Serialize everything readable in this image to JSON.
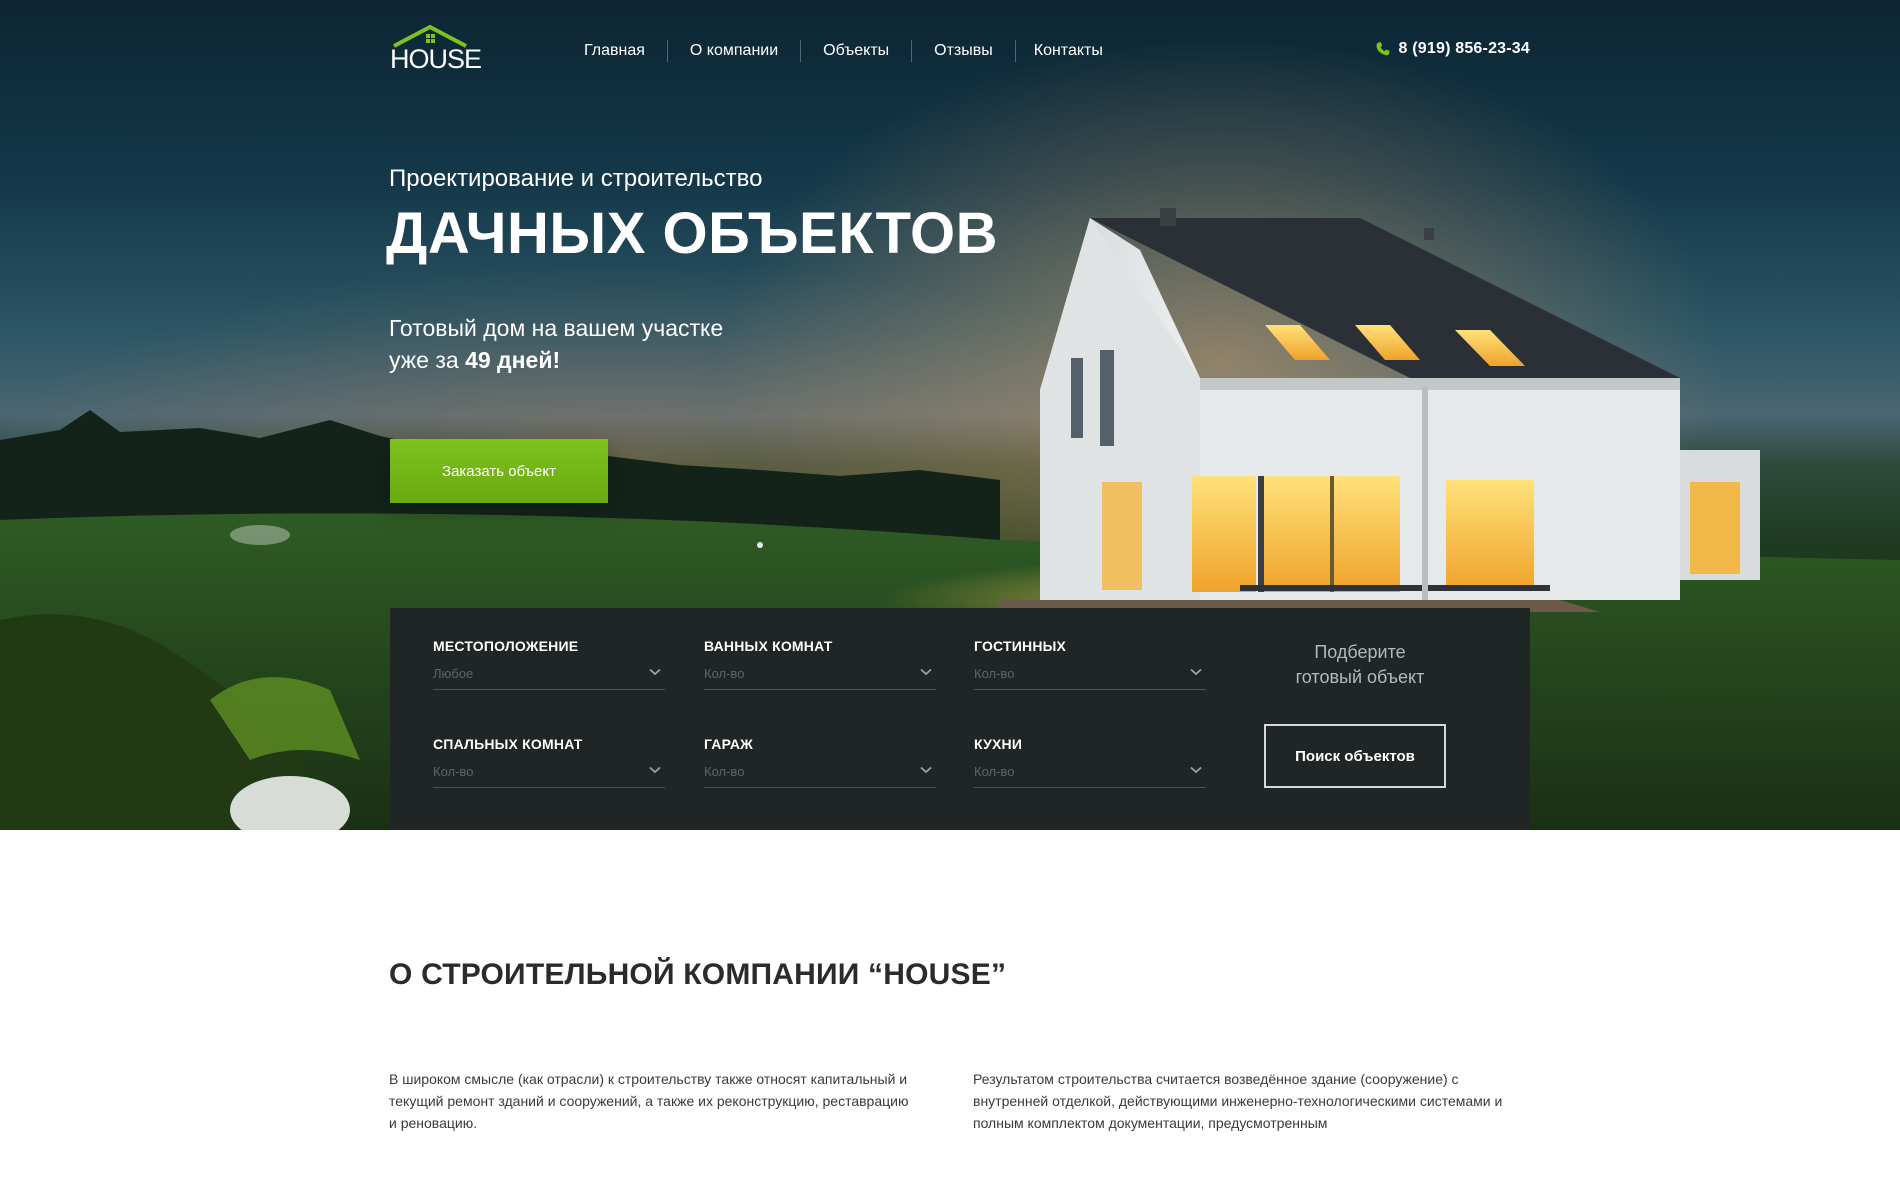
{
  "header": {
    "logo_text": "HOUSE",
    "nav": [
      "Главная",
      "О компании",
      "Объекты",
      "Отзывы",
      "Контакты"
    ],
    "phone": "8 (919) 856-23-34"
  },
  "hero": {
    "subtitle": "Проектирование и строительство",
    "title": "ДАЧНЫХ ОБЪЕКТОВ",
    "tagline_line1": "Готовый дом на вашем участке",
    "tagline_prefix": "уже за ",
    "tagline_bold": "49 дней!",
    "cta_label": "Заказать объект"
  },
  "search": {
    "fields": [
      {
        "label": "Местоположение",
        "value": "Любое"
      },
      {
        "label": "Ванных комнат",
        "value": "Кол-во"
      },
      {
        "label": "Гостинных",
        "value": "Кол-во"
      },
      {
        "label": "Спальных комнат",
        "value": "Кол-во"
      },
      {
        "label": "Гараж",
        "value": "Кол-во"
      },
      {
        "label": "Кухни",
        "value": "Кол-во"
      }
    ],
    "hint_line1": "Подберите",
    "hint_line2": "готовый объект",
    "button_label": "Поиск объектов"
  },
  "about": {
    "title": "О СТРОИТЕЛЬНОЙ КОМПАНИИ “HOUSE”",
    "left_text": "В широком смысле (как отрасли) к строительству также относят капитальный и текущий ремонт зданий и сооружений, а также их реконструкцию, реставрацию и реновацию.",
    "right_text": "Результатом строительства считается возведённое здание (сооружение) с внутренней отделкой, действующими инженерно-технологическими системами и полным комплектом документации, предусмотренным"
  },
  "colors": {
    "accent_green": "#7ec21d",
    "panel_bg": "#202626",
    "about_text": "#3a3a3a"
  },
  "icons": [
    "house-roof-logo-icon",
    "phone-icon",
    "chevron-down-icon"
  ]
}
